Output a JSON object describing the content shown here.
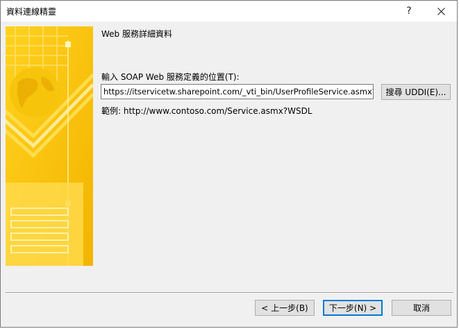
{
  "window": {
    "title": "資料連線精靈",
    "help_glyph": "?",
    "close_glyph": "✕"
  },
  "page": {
    "heading": "Web 服務詳細資料",
    "prompt_label": "輸入 SOAP Web 服務定義的位置(T):",
    "url_value": "https://itservicetw.sharepoint.com/_vti_bin/UserProfileService.asmx?WSDL",
    "search_uddi_label": "搜尋 UDDI(E)...",
    "example_text": "範例: http://www.contoso.com/Service.asmx?WSDL"
  },
  "footer": {
    "back_label": "< 上一步(B)",
    "next_label": "下一步(N) >",
    "cancel_label": "取消"
  },
  "colors": {
    "banner_base": "#f6c000",
    "banner_light": "#ffe25a",
    "accent_focus": "#0078d7"
  }
}
